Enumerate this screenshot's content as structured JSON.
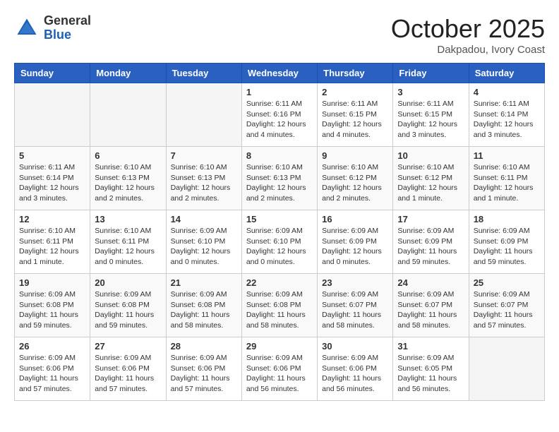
{
  "logo": {
    "general": "General",
    "blue": "Blue"
  },
  "title": "October 2025",
  "subtitle": "Dakpadou, Ivory Coast",
  "days_of_week": [
    "Sunday",
    "Monday",
    "Tuesday",
    "Wednesday",
    "Thursday",
    "Friday",
    "Saturday"
  ],
  "weeks": [
    [
      {
        "day": "",
        "info": ""
      },
      {
        "day": "",
        "info": ""
      },
      {
        "day": "",
        "info": ""
      },
      {
        "day": "1",
        "info": "Sunrise: 6:11 AM\nSunset: 6:16 PM\nDaylight: 12 hours\nand 4 minutes."
      },
      {
        "day": "2",
        "info": "Sunrise: 6:11 AM\nSunset: 6:15 PM\nDaylight: 12 hours\nand 4 minutes."
      },
      {
        "day": "3",
        "info": "Sunrise: 6:11 AM\nSunset: 6:15 PM\nDaylight: 12 hours\nand 3 minutes."
      },
      {
        "day": "4",
        "info": "Sunrise: 6:11 AM\nSunset: 6:14 PM\nDaylight: 12 hours\nand 3 minutes."
      }
    ],
    [
      {
        "day": "5",
        "info": "Sunrise: 6:11 AM\nSunset: 6:14 PM\nDaylight: 12 hours\nand 3 minutes."
      },
      {
        "day": "6",
        "info": "Sunrise: 6:10 AM\nSunset: 6:13 PM\nDaylight: 12 hours\nand 2 minutes."
      },
      {
        "day": "7",
        "info": "Sunrise: 6:10 AM\nSunset: 6:13 PM\nDaylight: 12 hours\nand 2 minutes."
      },
      {
        "day": "8",
        "info": "Sunrise: 6:10 AM\nSunset: 6:13 PM\nDaylight: 12 hours\nand 2 minutes."
      },
      {
        "day": "9",
        "info": "Sunrise: 6:10 AM\nSunset: 6:12 PM\nDaylight: 12 hours\nand 2 minutes."
      },
      {
        "day": "10",
        "info": "Sunrise: 6:10 AM\nSunset: 6:12 PM\nDaylight: 12 hours\nand 1 minute."
      },
      {
        "day": "11",
        "info": "Sunrise: 6:10 AM\nSunset: 6:11 PM\nDaylight: 12 hours\nand 1 minute."
      }
    ],
    [
      {
        "day": "12",
        "info": "Sunrise: 6:10 AM\nSunset: 6:11 PM\nDaylight: 12 hours\nand 1 minute."
      },
      {
        "day": "13",
        "info": "Sunrise: 6:10 AM\nSunset: 6:11 PM\nDaylight: 12 hours\nand 0 minutes."
      },
      {
        "day": "14",
        "info": "Sunrise: 6:09 AM\nSunset: 6:10 PM\nDaylight: 12 hours\nand 0 minutes."
      },
      {
        "day": "15",
        "info": "Sunrise: 6:09 AM\nSunset: 6:10 PM\nDaylight: 12 hours\nand 0 minutes."
      },
      {
        "day": "16",
        "info": "Sunrise: 6:09 AM\nSunset: 6:09 PM\nDaylight: 12 hours\nand 0 minutes."
      },
      {
        "day": "17",
        "info": "Sunrise: 6:09 AM\nSunset: 6:09 PM\nDaylight: 11 hours\nand 59 minutes."
      },
      {
        "day": "18",
        "info": "Sunrise: 6:09 AM\nSunset: 6:09 PM\nDaylight: 11 hours\nand 59 minutes."
      }
    ],
    [
      {
        "day": "19",
        "info": "Sunrise: 6:09 AM\nSunset: 6:08 PM\nDaylight: 11 hours\nand 59 minutes."
      },
      {
        "day": "20",
        "info": "Sunrise: 6:09 AM\nSunset: 6:08 PM\nDaylight: 11 hours\nand 59 minutes."
      },
      {
        "day": "21",
        "info": "Sunrise: 6:09 AM\nSunset: 6:08 PM\nDaylight: 11 hours\nand 58 minutes."
      },
      {
        "day": "22",
        "info": "Sunrise: 6:09 AM\nSunset: 6:08 PM\nDaylight: 11 hours\nand 58 minutes."
      },
      {
        "day": "23",
        "info": "Sunrise: 6:09 AM\nSunset: 6:07 PM\nDaylight: 11 hours\nand 58 minutes."
      },
      {
        "day": "24",
        "info": "Sunrise: 6:09 AM\nSunset: 6:07 PM\nDaylight: 11 hours\nand 58 minutes."
      },
      {
        "day": "25",
        "info": "Sunrise: 6:09 AM\nSunset: 6:07 PM\nDaylight: 11 hours\nand 57 minutes."
      }
    ],
    [
      {
        "day": "26",
        "info": "Sunrise: 6:09 AM\nSunset: 6:06 PM\nDaylight: 11 hours\nand 57 minutes."
      },
      {
        "day": "27",
        "info": "Sunrise: 6:09 AM\nSunset: 6:06 PM\nDaylight: 11 hours\nand 57 minutes."
      },
      {
        "day": "28",
        "info": "Sunrise: 6:09 AM\nSunset: 6:06 PM\nDaylight: 11 hours\nand 57 minutes."
      },
      {
        "day": "29",
        "info": "Sunrise: 6:09 AM\nSunset: 6:06 PM\nDaylight: 11 hours\nand 56 minutes."
      },
      {
        "day": "30",
        "info": "Sunrise: 6:09 AM\nSunset: 6:06 PM\nDaylight: 11 hours\nand 56 minutes."
      },
      {
        "day": "31",
        "info": "Sunrise: 6:09 AM\nSunset: 6:05 PM\nDaylight: 11 hours\nand 56 minutes."
      },
      {
        "day": "",
        "info": ""
      }
    ]
  ]
}
